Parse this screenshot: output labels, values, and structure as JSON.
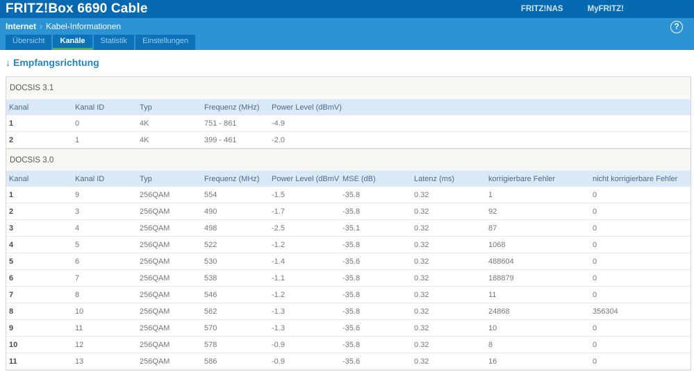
{
  "header": {
    "title": "FRITZ!Box 6690 Cable",
    "nav_links": [
      "FRITZ!NAS",
      "MyFRITZ!"
    ]
  },
  "breadcrumb": {
    "section": "Internet",
    "separator": "›",
    "page": "Kabel-Informationen"
  },
  "help_icon": "?",
  "tabs": [
    {
      "label": "Übersicht",
      "active": false
    },
    {
      "label": "Kanäle",
      "active": true
    },
    {
      "label": "Statistik",
      "active": false
    },
    {
      "label": "Einstellungen",
      "active": false
    }
  ],
  "section_heading": {
    "arrow": "↓",
    "label": "Empfangsrichtung"
  },
  "tables": [
    {
      "title": "DOCSIS 3.1",
      "columns": [
        "Kanal",
        "Kanal ID",
        "Typ",
        "Frequenz (MHz)",
        "Power Level (dBmV)"
      ],
      "rows": [
        [
          "1",
          "0",
          "4K",
          "751 - 861",
          "-4.9"
        ],
        [
          "2",
          "1",
          "4K",
          "399 - 461",
          "-2.0"
        ]
      ]
    },
    {
      "title": "DOCSIS 3.0",
      "columns": [
        "Kanal",
        "Kanal ID",
        "Typ",
        "Frequenz (MHz)",
        "Power Level (dBmV)",
        "MSE (dB)",
        "Latenz (ms)",
        "korrigierbare Fehler",
        "nicht korrigierbare Fehler"
      ],
      "rows": [
        [
          "1",
          "9",
          "256QAM",
          "554",
          "-1.5",
          "-35.8",
          "0.32",
          "1",
          "0"
        ],
        [
          "2",
          "3",
          "256QAM",
          "490",
          "-1.7",
          "-35.8",
          "0.32",
          "92",
          "0"
        ],
        [
          "3",
          "4",
          "256QAM",
          "498",
          "-2.5",
          "-35.1",
          "0.32",
          "87",
          "0"
        ],
        [
          "4",
          "5",
          "256QAM",
          "522",
          "-1.2",
          "-35.8",
          "0.32",
          "1068",
          "0"
        ],
        [
          "5",
          "6",
          "256QAM",
          "530",
          "-1.4",
          "-35.6",
          "0.32",
          "488604",
          "0"
        ],
        [
          "6",
          "7",
          "256QAM",
          "538",
          "-1.1",
          "-35.8",
          "0.32",
          "188879",
          "0"
        ],
        [
          "7",
          "8",
          "256QAM",
          "546",
          "-1.2",
          "-35.8",
          "0.32",
          "11",
          "0"
        ],
        [
          "8",
          "10",
          "256QAM",
          "562",
          "-1.3",
          "-35.8",
          "0.32",
          "24868",
          "356304"
        ],
        [
          "9",
          "11",
          "256QAM",
          "570",
          "-1.3",
          "-35.6",
          "0.32",
          "10",
          "0"
        ],
        [
          "10",
          "12",
          "256QAM",
          "578",
          "-0.9",
          "-35.8",
          "0.32",
          "8",
          "0"
        ],
        [
          "11",
          "13",
          "256QAM",
          "586",
          "-0.9",
          "-35.6",
          "0.32",
          "16",
          "0"
        ]
      ]
    }
  ],
  "colors": {
    "topbar": "#0769b2",
    "subbar": "#2c93d5",
    "tab": "#0d72b8",
    "tab_text": "#9dcdee",
    "tab_active_text": "#ffffff",
    "green": "#55b14b",
    "heading": "#2185c5",
    "border": "#d8d6d2",
    "section_bg": "#f8f7f4",
    "section_text": "#585858",
    "thead_bg": "#d9e9f7",
    "thead_text": "#4d6b85",
    "cell_text": "#767676",
    "cell_strong": "#4a4a4a",
    "row_border": "#e8e8e8"
  }
}
